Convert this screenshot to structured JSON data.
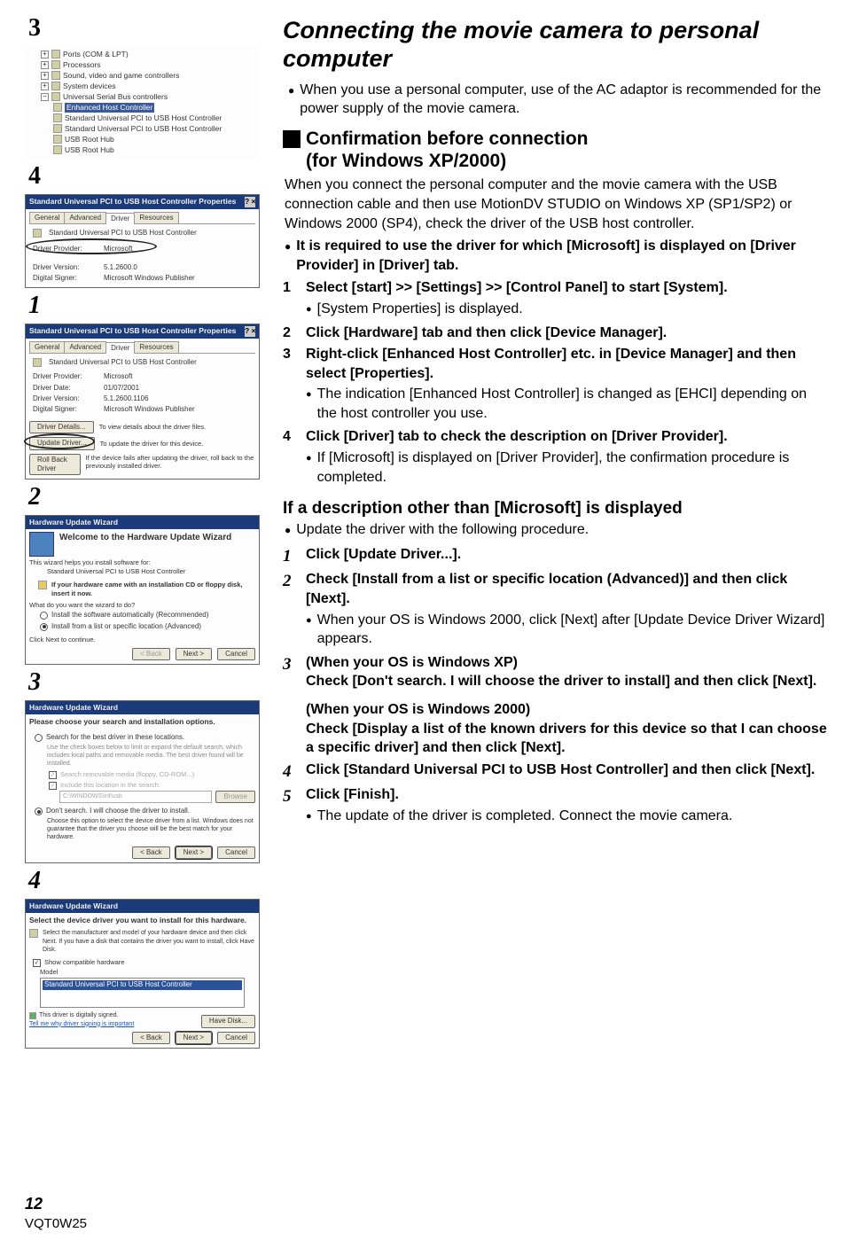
{
  "footer": {
    "page": "12",
    "docid": "VQT0W25"
  },
  "left": {
    "labels": {
      "n3": "3",
      "n4": "4",
      "n1b": "1",
      "n2b": "2",
      "n3b": "3",
      "n4b": "4"
    },
    "tree": {
      "nodes": {
        "ports": "Ports (COM & LPT)",
        "processors": "Processors",
        "sound": "Sound, video and game controllers",
        "sysdev": "System devices",
        "usb": "Universal Serial Bus controllers",
        "ehc": "Enhanced Host Controller",
        "std1": "Standard Universal PCI to USB Host Controller",
        "std2": "Standard Universal PCI to USB Host Controller",
        "root1": "USB Root Hub",
        "root2": "USB Root Hub"
      }
    },
    "dlg1": {
      "title": "Standard Universal PCI to USB Host Controller Properties",
      "tabs": {
        "general": "General",
        "advanced": "Advanced",
        "driver": "Driver",
        "resources": "Resources"
      },
      "device": "Standard Universal PCI to USB Host Controller",
      "rows": {
        "provLabel": "Driver Provider:",
        "prov": "Microsoft",
        "verLabel": "Driver Version:",
        "ver": "5.1.2600.0",
        "sigLabel": "Digital Signer:",
        "sig": "Microsoft Windows Publisher"
      }
    },
    "dlg2": {
      "title": "Standard Universal PCI to USB Host Controller Properties",
      "device": "Standard Universal PCI to USB Host Controller",
      "rows": {
        "provLabel": "Driver Provider:",
        "prov": "Microsoft",
        "dateLabel": "Driver Date:",
        "date": "01/07/2001",
        "verLabel": "Driver Version:",
        "ver": "5.1.2600.1106",
        "sigLabel": "Digital Signer:",
        "sig": "Microsoft Windows Publisher"
      },
      "btnDetails": "Driver Details...",
      "btnDetailsDesc": "To view details about the driver files.",
      "btnUpdate": "Update Driver...",
      "btnUpdateDesc": "To update the driver for this device.",
      "btnRoll": "Roll Back Driver",
      "btnRollDesc": "If the device fails after updating the driver, roll back to the previously installed driver."
    },
    "wiz1": {
      "title": "Hardware Update Wizard",
      "h": "Welcome to the Hardware Update Wizard",
      "p1": "This wizard helps you install software for:",
      "p2": "Standard Universal PCI to USB Host Controller",
      "p3": "If your hardware came with an installation CD or floppy disk, insert it now.",
      "q": "What do you want the wizard to do?",
      "r1": "Install the software automatically (Recommended)",
      "r2": "Install from a list or specific location (Advanced)",
      "p4": "Click Next to continue.",
      "back": "< Back",
      "next": "Next >",
      "cancel": "Cancel"
    },
    "wiz2": {
      "title": "Hardware Update Wizard",
      "h": "Please choose your search and installation options.",
      "r1": "Search for the best driver in these locations.",
      "r1d": "Use the check boxes below to limit or expand the default search, which includes local paths and removable media. The best driver found will be installed.",
      "c1": "Search removable media (floppy, CD-ROM...)",
      "c2": "Include this location in the search:",
      "path": "C:\\WINDOWS\\inf\\usb",
      "browse": "Browse",
      "r2": "Don't search. I will choose the driver to install.",
      "r2d": "Choose this option to select the device driver from a list. Windows does not guarantee that the driver you choose will be the best match for your hardware.",
      "back": "< Back",
      "next": "Next >",
      "cancel": "Cancel"
    },
    "wiz3": {
      "title": "Hardware Update Wizard",
      "h": "Select the device driver you want to install for this hardware.",
      "p": "Select the manufacturer and model of your hardware device and then click Next. If you have a disk that contains the driver you want to install, click Have Disk.",
      "chk": "Show compatible hardware",
      "model": "Model",
      "item": "Standard Universal PCI to USB Host Controller",
      "signed": "This driver is digitally signed.",
      "tell": "Tell me why driver signing is important",
      "haveDisk": "Have Disk...",
      "back": "< Back",
      "next": "Next >",
      "cancel": "Cancel"
    }
  },
  "right": {
    "title": "Connecting the movie camera to personal computer",
    "intro": "When you use a personal computer, use of the AC adaptor is recommended for the power supply of the movie camera.",
    "h2a": "Confirmation before connection",
    "h2b": "(for Windows XP/2000)",
    "p1": "When you connect the personal computer and the movie camera with the USB connection cable and then use MotionDV STUDIO on Windows XP (SP1/SP2) or Windows 2000 (SP4), check the driver of the USB host controller.",
    "note": "It is required to use the driver for which [Microsoft] is displayed on [Driver Provider] in [Driver] tab.",
    "steps": {
      "s1": "Select [start] >> [Settings] >> [Control Panel] to start [System].",
      "s1b": "[System Properties] is displayed.",
      "s2": "Click [Hardware] tab and then click [Device Manager].",
      "s3": "Right-click [Enhanced Host Controller] etc. in [Device Manager] and then select [Properties].",
      "s3b": "The indication [Enhanced Host Controller] is changed as [EHCI] depending on the host controller you use.",
      "s4": "Click [Driver] tab to check the description on [Driver Provider].",
      "s4b": "If [Microsoft] is displayed on [Driver Provider], the confirmation procedure is completed."
    },
    "sub": "If a description other than [Microsoft] is displayed",
    "subp": "Update the driver with the following procedure.",
    "isteps": {
      "i1": "Click [Update Driver...].",
      "i2": "Check [Install from a list or specific location (Advanced)] and then click [Next].",
      "i2b": "When your OS is Windows 2000, click [Next] after [Update Device Driver Wizard] appears.",
      "i3a": "(When your OS is Windows XP)",
      "i3b": "Check [Don't search. I will choose the driver to install] and then click [Next].",
      "i3c": "(When your OS is Windows 2000)",
      "i3d": "Check [Display a list of the known drivers for this device so that I can choose a specific driver] and then click [Next].",
      "i4": "Click [Standard Universal PCI to USB Host Controller] and then click [Next].",
      "i5": "Click [Finish].",
      "i5b": "The update of the driver is completed. Connect the movie camera."
    }
  }
}
